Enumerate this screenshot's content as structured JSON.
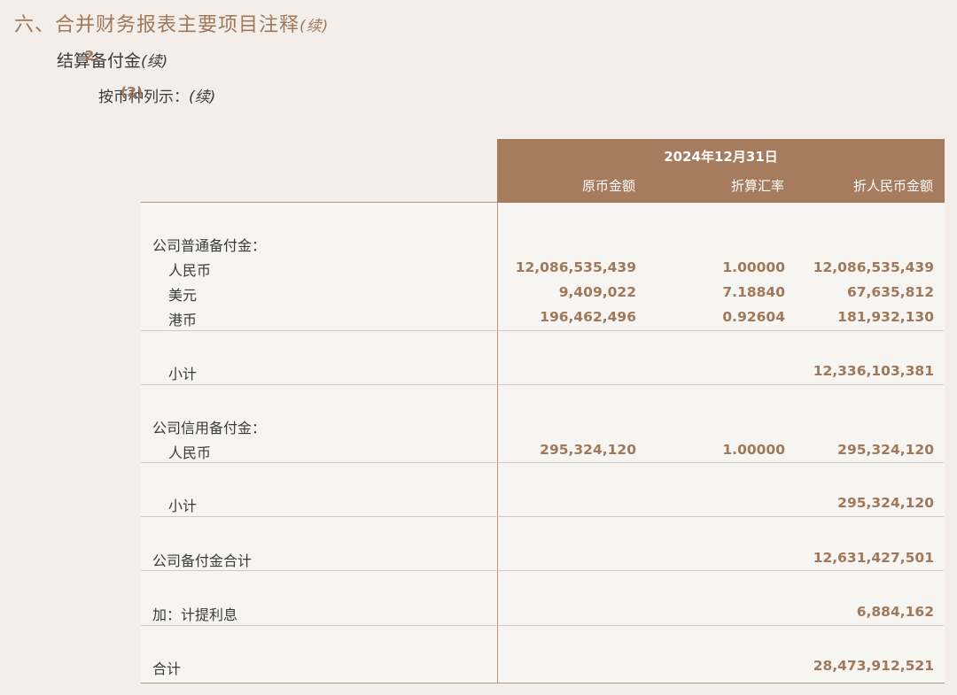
{
  "headings": {
    "h1": "六、合并财务报表主要项目注释",
    "h1_cont": "(续)",
    "h2_num": "2.",
    "h2_text": "结算备付金",
    "h2_cont": "(续)",
    "h3_num": "(2)",
    "h3_text": "按币种列示：",
    "h3_cont": "(续)"
  },
  "table": {
    "date": "2024年12月31日",
    "columns": [
      "原币金额",
      "折算汇率",
      "折人民币金额"
    ],
    "section1_title": "公司普通备付金：",
    "section1_rows": [
      {
        "label": "人民币",
        "orig": "12,086,535,439",
        "rate": "1.00000",
        "rmb": "12,086,535,439"
      },
      {
        "label": "美元",
        "orig": "9,409,022",
        "rate": "7.18840",
        "rmb": "67,635,812"
      },
      {
        "label": "港币",
        "orig": "196,462,496",
        "rate": "0.92604",
        "rmb": "181,932,130"
      }
    ],
    "subtotal1_label": "小计",
    "subtotal1_rmb": "12,336,103,381",
    "section2_title": "公司信用备付金：",
    "section2_rows": [
      {
        "label": "人民币",
        "orig": "295,324,120",
        "rate": "1.00000",
        "rmb": "295,324,120"
      }
    ],
    "subtotal2_label": "小计",
    "subtotal2_rmb": "295,324,120",
    "company_total_label": "公司备付金合计",
    "company_total_rmb": "12,631,427,501",
    "interest_label": "加：计提利息",
    "interest_rmb": "6,884,162",
    "grand_total_label": "合计",
    "grand_total_rmb": "28,473,912,521"
  }
}
